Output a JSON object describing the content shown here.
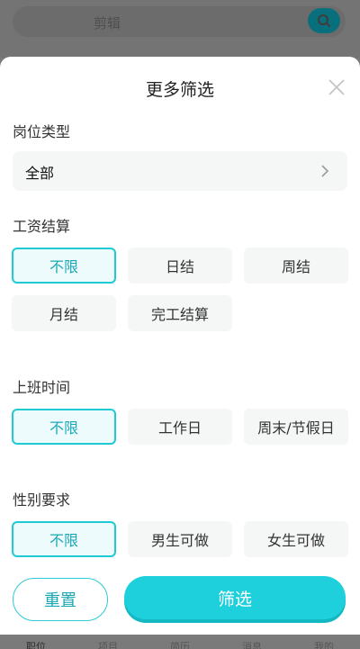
{
  "background": {
    "search_text": "剪辑",
    "tabs": [
      {
        "label": "职位",
        "active": true
      },
      {
        "label": "项目",
        "active": false
      },
      {
        "label": "简历",
        "active": false
      },
      {
        "label": "消息",
        "active": false
      },
      {
        "label": "我的",
        "active": false
      }
    ],
    "accent": "#0a6f7c"
  },
  "panel": {
    "title": "更多筛选",
    "sections": {
      "job_type": {
        "title": "岗位类型",
        "value": "全部"
      },
      "salary": {
        "title": "工资结算",
        "options": [
          "不限",
          "日结",
          "周结",
          "月结",
          "完工结算"
        ],
        "selected": "不限"
      },
      "work_time": {
        "title": "上班时间",
        "options": [
          "不限",
          "工作日",
          "周末/节假日"
        ],
        "selected": "不限"
      },
      "gender": {
        "title": "性别要求",
        "options": [
          "不限",
          "男生可做",
          "女生可做"
        ],
        "selected": "不限"
      }
    },
    "buttons": {
      "reset": "重置",
      "filter": "筛选"
    },
    "colors": {
      "accent": "#1dd0db",
      "selected_border": "#1ecbd4",
      "option_bg": "#f5f6f6"
    }
  }
}
